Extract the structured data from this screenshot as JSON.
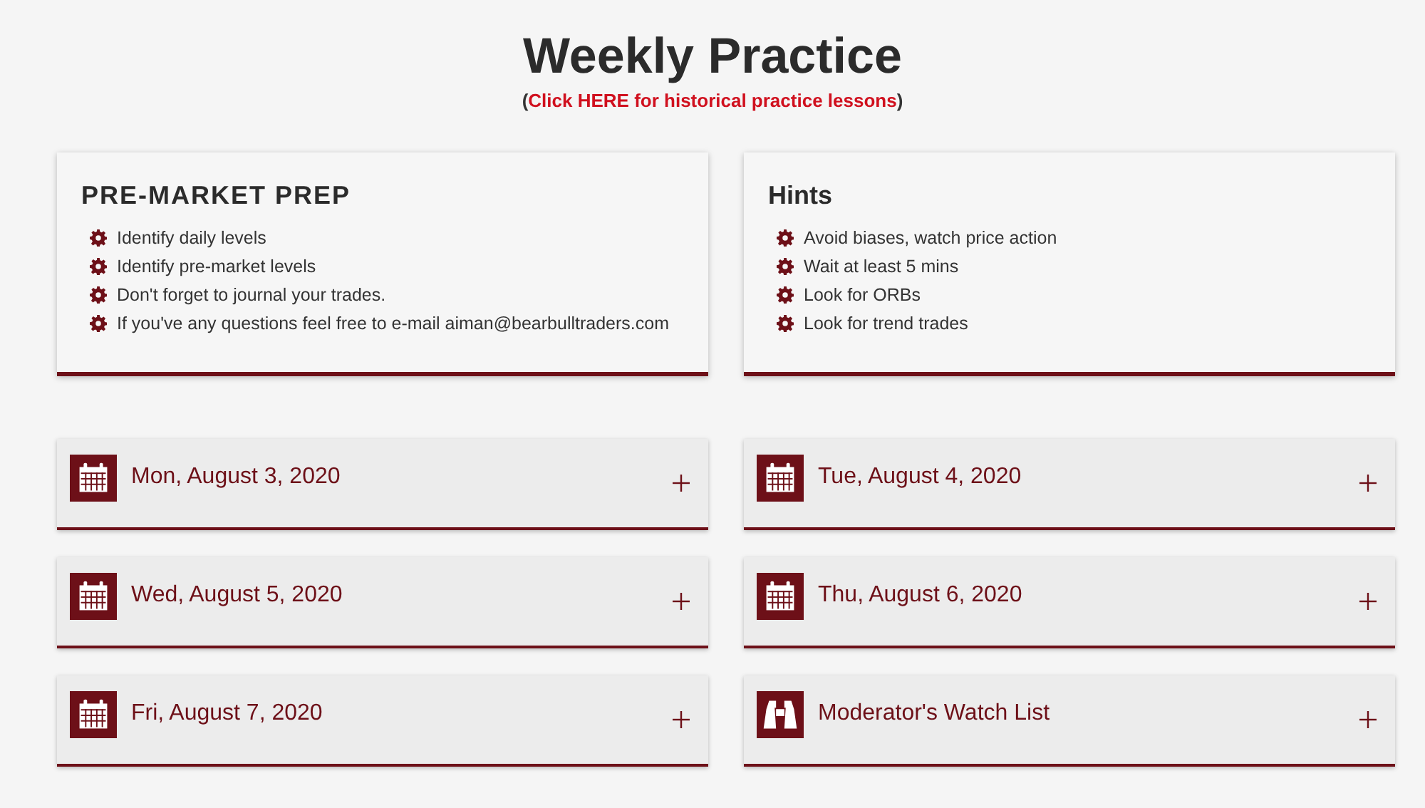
{
  "title": "Weekly Practice",
  "history_note": {
    "before": "(",
    "link": "Click HERE for historical practice lessons",
    "after": ")"
  },
  "cards": [
    {
      "title": "PRE-MARKET PREP",
      "uppercase_style": true,
      "items": [
        "Identify daily levels",
        "Identify pre-market levels",
        "Don't forget to journal your trades.",
        "If you've any questions feel free to e-mail aiman@bearbulltraders.com"
      ]
    },
    {
      "title": "Hints",
      "uppercase_style": false,
      "items": [
        "Avoid biases, watch price action",
        "Wait at least 5 mins",
        "Look for ORBs",
        "Look for trend trades"
      ]
    }
  ],
  "sections": [
    {
      "kind": "calendar",
      "label": "Mon, August 3, 2020",
      "expanded": false
    },
    {
      "kind": "calendar",
      "label": "Tue, August 4, 2020",
      "expanded": false
    },
    {
      "kind": "calendar",
      "label": "Wed, August 5, 2020",
      "expanded": false
    },
    {
      "kind": "calendar",
      "label": "Thu, August 6, 2020",
      "expanded": false
    },
    {
      "kind": "calendar",
      "label": "Fri, August 7, 2020",
      "expanded": false
    },
    {
      "kind": "binoculars",
      "label": "Moderator's Watch List",
      "expanded": false
    }
  ]
}
